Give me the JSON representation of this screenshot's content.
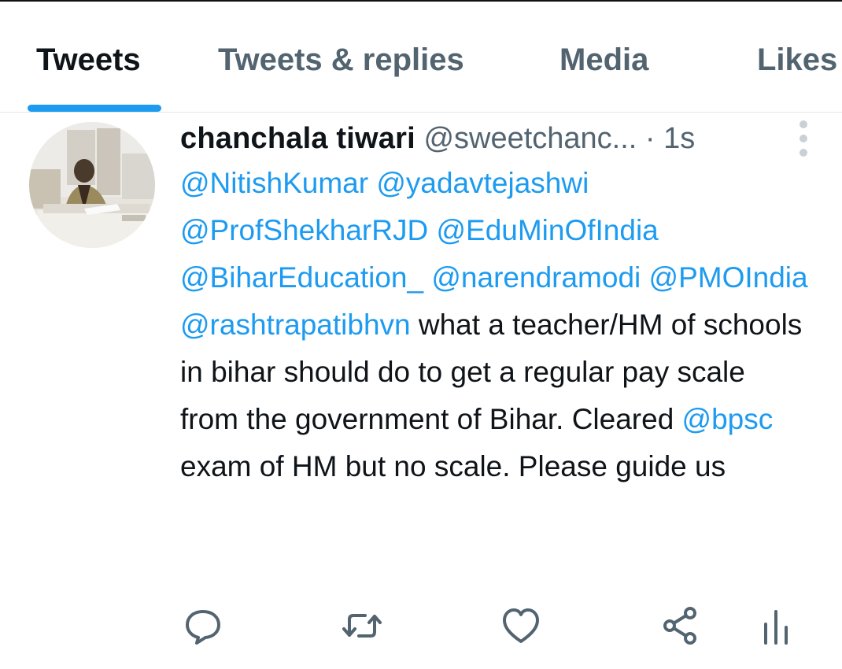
{
  "tabs": [
    {
      "label": "Tweets",
      "active": true
    },
    {
      "label": "Tweets & replies",
      "active": false
    },
    {
      "label": "Media",
      "active": false
    },
    {
      "label": "Likes",
      "active": false
    }
  ],
  "tweet": {
    "display_name": "chanchala tiwari",
    "handle": "@sweetchanc...",
    "separator": "·",
    "time": "1s",
    "mentions": {
      "m1": "@NitishKumar",
      "m2": "@yadavtejashwi",
      "m3": "@ProfShekharRJD",
      "m4": "@EduMinOfIndia",
      "m5": "@BiharEducation_",
      "m6": "@narendramodi",
      "m7": "@PMOIndia",
      "m8": "@rashtrapatibhvn",
      "m9": "@bpsc"
    },
    "text_parts": {
      "t1": " what a teacher/HM of schools in bihar should do to get a regular pay scale from the government of Bihar. Cleared ",
      "t2": " exam of HM but no scale. Please guide us"
    }
  },
  "actions": [
    "reply-icon",
    "retweet-icon",
    "like-icon",
    "share-icon",
    "analytics-icon"
  ],
  "colors": {
    "accent": "#1d9bf0",
    "text": "#0f1419",
    "muted": "#536471",
    "divider": "#e3e7ea"
  }
}
